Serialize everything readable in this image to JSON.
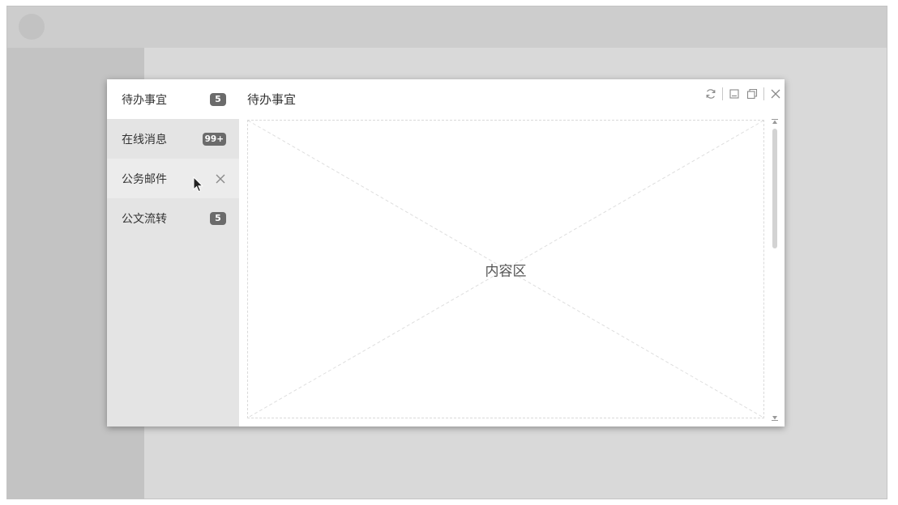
{
  "sidebar_items": [
    {
      "label": "待办事宜",
      "badge": "5"
    },
    {
      "label": "在线消息",
      "badge": "99+"
    },
    {
      "label": "公务邮件"
    },
    {
      "label": "公文流转",
      "badge": "5"
    }
  ],
  "panel": {
    "title": "待办事宜",
    "content_label": "内容区"
  },
  "icons": {
    "refresh": "refresh-icon",
    "minimize": "minimize-icon",
    "restore": "restore-icon",
    "close": "close-icon",
    "item_close": "close-icon",
    "cursor": "mouse-cursor-icon",
    "scroll_up": "scroll-top-icon",
    "scroll_down": "scroll-bottom-icon"
  },
  "colors": {
    "badge_bg": "#6b6b6b",
    "sidebar_bg": "#e4e4e4",
    "active_bg": "#ffffff",
    "hover_bg": "#ececec",
    "backdrop": "#d9d9d9"
  }
}
